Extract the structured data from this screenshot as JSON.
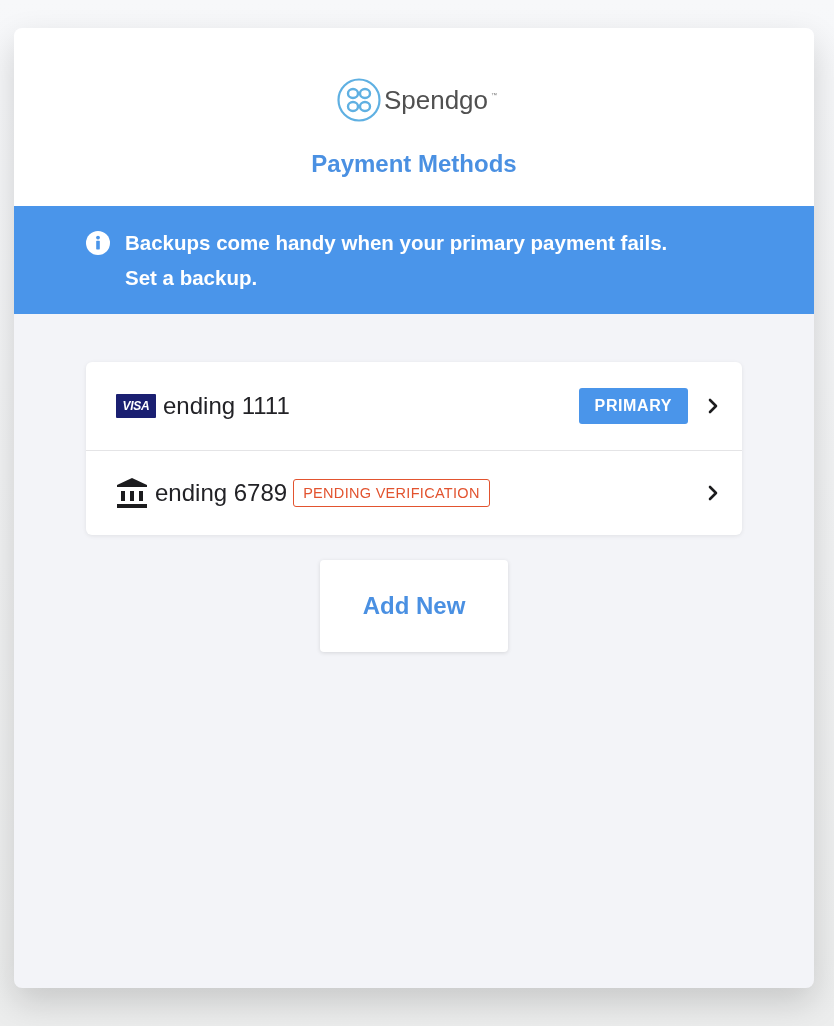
{
  "logo": {
    "name": "Spendgo",
    "trademark": "™"
  },
  "title": "Payment Methods",
  "banner": {
    "lines": [
      "Backups come handy when your primary payment fails.",
      "Set a backup."
    ]
  },
  "methods": [
    {
      "kind": "card",
      "brand": "VISA",
      "label": "ending 1111",
      "badge": {
        "kind": "primary",
        "text": "PRIMARY"
      }
    },
    {
      "kind": "bank",
      "label": "ending 6789",
      "badge": {
        "kind": "pending",
        "text": "PENDING VERIFICATION"
      }
    }
  ],
  "add_button": "Add New"
}
